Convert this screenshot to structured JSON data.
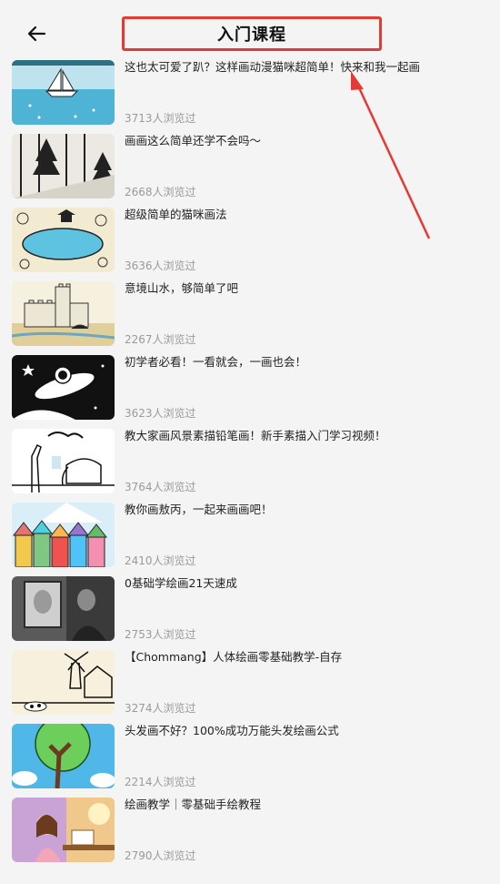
{
  "header": {
    "title": "入门课程",
    "back_icon": "arrow-left-icon"
  },
  "courses": [
    {
      "title": "这也太可爱了趴？这样画动漫猫咪超简单！快来和我一起画",
      "views": "3713人浏览过",
      "thumb": "sailboat-sea"
    },
    {
      "title": "画画这么简单还学不会吗～",
      "views": "2668人浏览过",
      "thumb": "forest-sketch"
    },
    {
      "title": "超级简单的猫咪画法",
      "views": "3636人浏览过",
      "thumb": "park-pond"
    },
    {
      "title": "意境山水，够简单了吧",
      "views": "2267人浏览过",
      "thumb": "castle"
    },
    {
      "title": "初学者必看！一看就会，一画也会！",
      "views": "3623人浏览过",
      "thumb": "rocket-space"
    },
    {
      "title": "教大家画风景素描铅笔画！新手素描入门学习视频！",
      "views": "3764人浏览过",
      "thumb": "zoo-animals"
    },
    {
      "title": "教你画敖丙，一起来画画吧！",
      "views": "2410人浏览过",
      "thumb": "colorful-houses"
    },
    {
      "title": "0基础学绘画21天速成",
      "views": "2753人浏览过",
      "thumb": "artist-photo"
    },
    {
      "title": "【Chommang】人体绘画零基础教学-自存",
      "views": "3274人浏览过",
      "thumb": "farm-windmill"
    },
    {
      "title": "头发画不好？100%成功万能头发绘画公式",
      "views": "2214人浏览过",
      "thumb": "tree-sky"
    },
    {
      "title": "绘画教学｜零基础手绘教程",
      "views": "2790人浏览过",
      "thumb": "girl-painting"
    }
  ],
  "colors": {
    "annotation": "#e53935",
    "background": "#f4f4f4",
    "views_text": "#9a9a9a"
  }
}
